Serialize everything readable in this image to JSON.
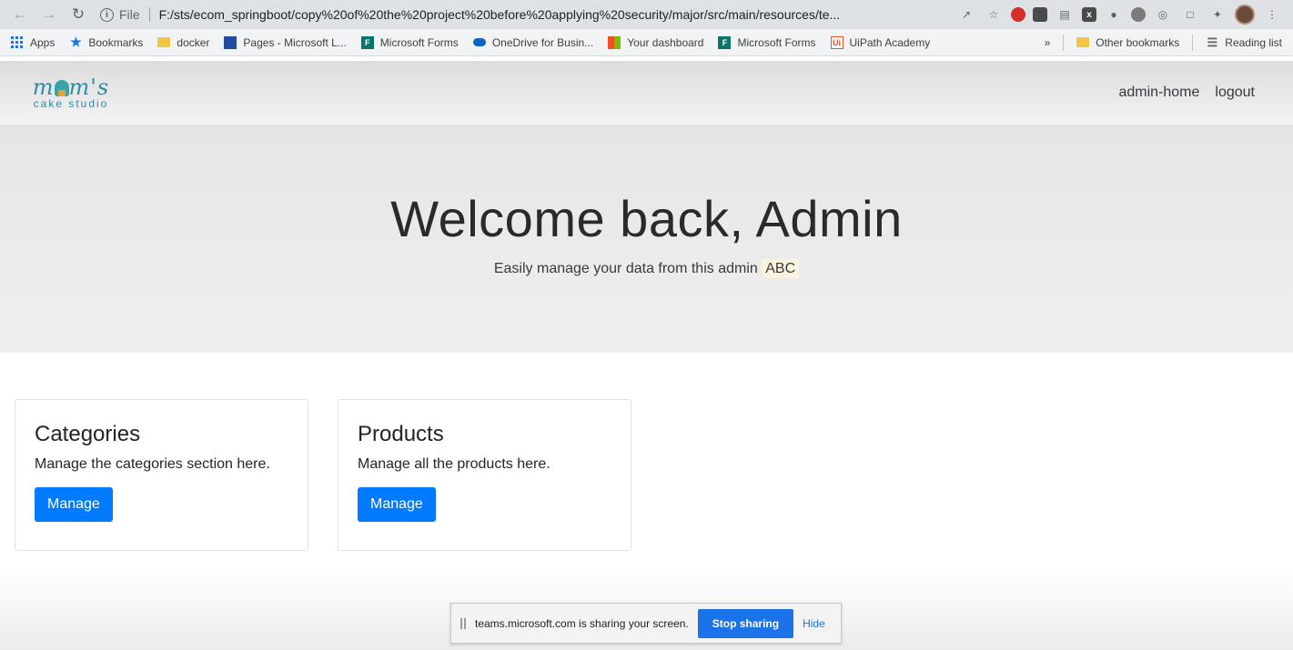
{
  "browser": {
    "url_label": "File",
    "url": "F:/sts/ecom_springboot/copy%20of%20the%20project%20before%20applying%20security/major/src/main/resources/te...",
    "bookmarks": [
      {
        "label": "Apps",
        "icon": "apps-grid-icon"
      },
      {
        "label": "Bookmarks",
        "icon": "star-icon"
      },
      {
        "label": "docker",
        "icon": "folder-icon"
      },
      {
        "label": "Pages - Microsoft L...",
        "icon": "pages-icon"
      },
      {
        "label": "Microsoft Forms",
        "icon": "forms-icon"
      },
      {
        "label": "OneDrive for Busin...",
        "icon": "onedrive-icon"
      },
      {
        "label": "Your dashboard",
        "icon": "windows-icon"
      },
      {
        "label": "Microsoft Forms",
        "icon": "forms-icon"
      },
      {
        "label": "UiPath Academy",
        "icon": "uipath-icon"
      }
    ],
    "more": "»",
    "other_bookmarks": "Other bookmarks",
    "reading_list": "Reading list"
  },
  "site": {
    "logo_main": "m m's",
    "logo_sub": "cake studio",
    "nav": {
      "admin_home": "admin-home",
      "logout": "logout"
    }
  },
  "hero": {
    "title": "Welcome back, Admin",
    "subtitle": "Easily manage your data from this admin",
    "highlight": "ABC"
  },
  "cards": [
    {
      "title": "Categories",
      "text": "Manage the categories section here.",
      "button": "Manage"
    },
    {
      "title": "Products",
      "text": "Manage all the products here.",
      "button": "Manage"
    }
  ],
  "share_bar": {
    "message": "teams.microsoft.com is sharing your screen.",
    "stop": "Stop sharing",
    "hide": "Hide"
  },
  "colors": {
    "primary": "#007bff",
    "logo": "#2e8da6",
    "share_blue": "#1a73e8"
  }
}
